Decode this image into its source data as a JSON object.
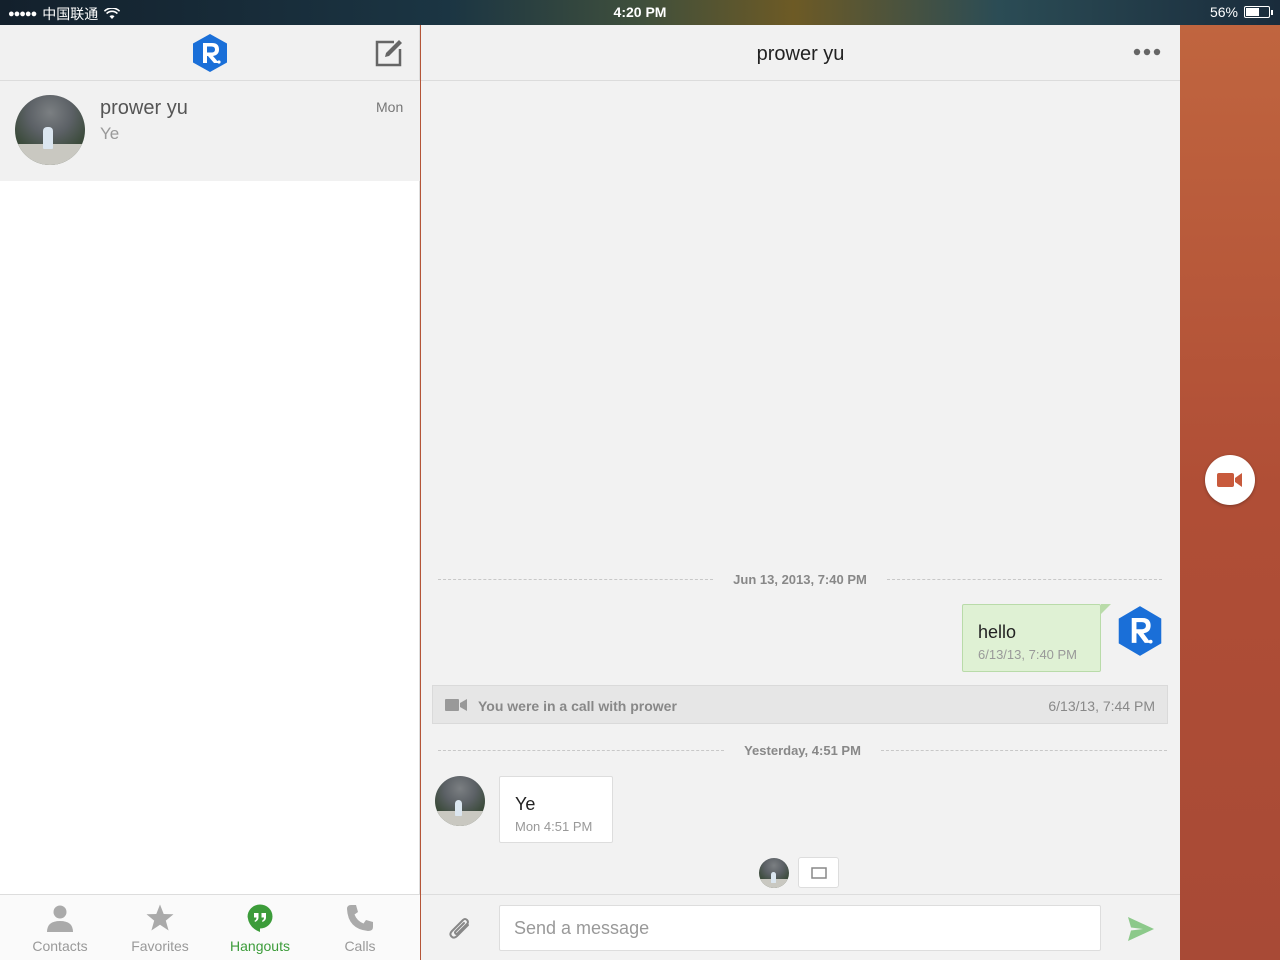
{
  "status_bar": {
    "carrier": "中国联通",
    "time": "4:20 PM",
    "battery": "56%"
  },
  "sidebar": {
    "conversations": [
      {
        "name": "prower yu",
        "snippet": "Ye",
        "time": "Mon"
      }
    ],
    "tabs": [
      {
        "label": "Contacts",
        "icon": "person-icon",
        "active": false
      },
      {
        "label": "Favorites",
        "icon": "star-icon",
        "active": false
      },
      {
        "label": "Hangouts",
        "icon": "hangouts-icon",
        "active": true
      },
      {
        "label": "Calls",
        "icon": "phone-icon",
        "active": false
      }
    ]
  },
  "chat": {
    "title": "prower yu",
    "dividers": [
      {
        "label": "Jun 13, 2013, 7:40 PM"
      },
      {
        "label": "Yesterday, 4:51 PM"
      }
    ],
    "messages": [
      {
        "direction": "outgoing",
        "text": "hello",
        "timestamp": "6/13/13, 7:40 PM"
      },
      {
        "direction": "incoming",
        "text": "Ye",
        "timestamp": "Mon 4:51 PM"
      }
    ],
    "call_event": {
      "text": "You were in a call with prower",
      "timestamp": "6/13/13, 7:44 PM"
    },
    "composer": {
      "placeholder": "Send a message"
    }
  },
  "colors": {
    "accent_green": "#3c9c3a",
    "brand_blue": "#1a6fd8",
    "outgoing_bubble": "#dff1d4"
  }
}
